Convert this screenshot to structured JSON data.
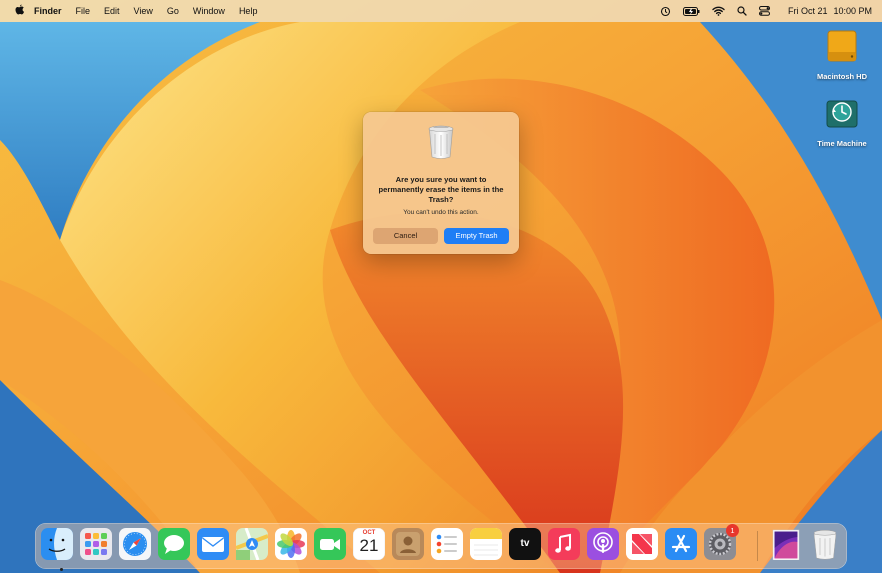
{
  "menubar": {
    "app_name": "Finder",
    "menus": [
      "File",
      "Edit",
      "View",
      "Go",
      "Window",
      "Help"
    ],
    "status_icons": [
      "time-machine-icon",
      "battery-icon",
      "wifi-icon",
      "search-icon",
      "control-center-icon"
    ],
    "clock": {
      "date": "Fri Oct 21",
      "time": "10:00 PM"
    }
  },
  "desktop": {
    "icons": [
      {
        "label": "Macintosh HD",
        "icon": "hard-drive-icon"
      },
      {
        "label": "Time Machine",
        "icon": "time-machine-icon"
      }
    ]
  },
  "dialog": {
    "title": "Are you sure you want to permanently erase the items in the Trash?",
    "message": "You can't undo this action.",
    "cancel_label": "Cancel",
    "confirm_label": "Empty Trash"
  },
  "dock": {
    "apps": [
      {
        "name": "Finder",
        "icon": "finder-icon",
        "running": true
      },
      {
        "name": "Launchpad",
        "icon": "launchpad-icon"
      },
      {
        "name": "Safari",
        "icon": "safari-icon"
      },
      {
        "name": "Messages",
        "icon": "messages-icon"
      },
      {
        "name": "Mail",
        "icon": "mail-icon"
      },
      {
        "name": "Maps",
        "icon": "maps-icon"
      },
      {
        "name": "Photos",
        "icon": "photos-icon"
      },
      {
        "name": "FaceTime",
        "icon": "facetime-icon"
      },
      {
        "name": "Calendar",
        "icon": "calendar-icon",
        "month": "OCT",
        "day": "21"
      },
      {
        "name": "Contacts",
        "icon": "contacts-icon"
      },
      {
        "name": "Reminders",
        "icon": "reminders-icon"
      },
      {
        "name": "Notes",
        "icon": "notes-icon"
      },
      {
        "name": "TV",
        "icon": "tv-icon",
        "label": "tv"
      },
      {
        "name": "Music",
        "icon": "music-icon"
      },
      {
        "name": "Podcasts",
        "icon": "podcasts-icon"
      },
      {
        "name": "News",
        "icon": "news-icon"
      },
      {
        "name": "App Store",
        "icon": "app-store-icon"
      },
      {
        "name": "System Settings",
        "icon": "system-settings-icon",
        "badge": "1"
      }
    ],
    "others": [
      {
        "name": "Downloads",
        "icon": "downloads-stack-icon"
      },
      {
        "name": "Trash",
        "icon": "trash-icon"
      }
    ]
  },
  "colors": {
    "accent": "#1f7ef5",
    "badge": "#e8362c",
    "wallpaper_orange": "#f39a2d"
  }
}
